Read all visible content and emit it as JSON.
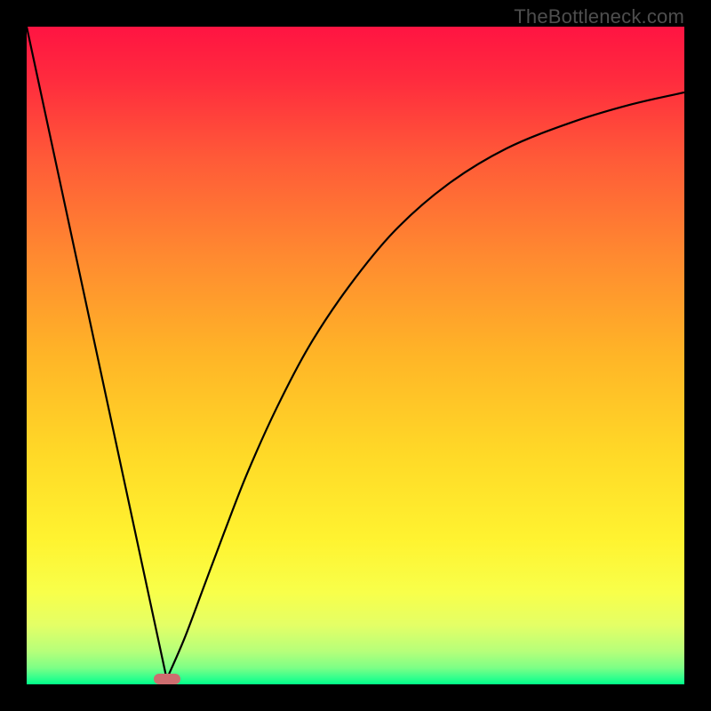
{
  "watermark": "TheBottleneck.com",
  "gradient_stops": [
    {
      "offset": 0.0,
      "color": "#ff1442"
    },
    {
      "offset": 0.08,
      "color": "#ff2b3e"
    },
    {
      "offset": 0.2,
      "color": "#ff5a38"
    },
    {
      "offset": 0.35,
      "color": "#ff8a30"
    },
    {
      "offset": 0.5,
      "color": "#ffb527"
    },
    {
      "offset": 0.65,
      "color": "#ffd927"
    },
    {
      "offset": 0.78,
      "color": "#fff330"
    },
    {
      "offset": 0.86,
      "color": "#f8ff4a"
    },
    {
      "offset": 0.91,
      "color": "#e4ff66"
    },
    {
      "offset": 0.95,
      "color": "#b6ff7a"
    },
    {
      "offset": 0.975,
      "color": "#7cff86"
    },
    {
      "offset": 0.99,
      "color": "#33ff8d"
    },
    {
      "offset": 1.0,
      "color": "#00ff88"
    }
  ],
  "marker": {
    "x_frac": 0.213,
    "y_frac": 0.992,
    "color": "#cd6d6f"
  },
  "curve_left": {
    "start": {
      "x_frac": 0.0,
      "y_frac": 0.0
    },
    "end": {
      "x_frac": 0.213,
      "y_frac": 0.992
    }
  },
  "curve_right": {
    "samples": [
      {
        "x_frac": 0.213,
        "y_frac": 0.992
      },
      {
        "x_frac": 0.24,
        "y_frac": 0.93
      },
      {
        "x_frac": 0.27,
        "y_frac": 0.85
      },
      {
        "x_frac": 0.3,
        "y_frac": 0.77
      },
      {
        "x_frac": 0.335,
        "y_frac": 0.68
      },
      {
        "x_frac": 0.38,
        "y_frac": 0.58
      },
      {
        "x_frac": 0.43,
        "y_frac": 0.485
      },
      {
        "x_frac": 0.49,
        "y_frac": 0.395
      },
      {
        "x_frac": 0.56,
        "y_frac": 0.31
      },
      {
        "x_frac": 0.64,
        "y_frac": 0.24
      },
      {
        "x_frac": 0.73,
        "y_frac": 0.185
      },
      {
        "x_frac": 0.83,
        "y_frac": 0.145
      },
      {
        "x_frac": 0.92,
        "y_frac": 0.118
      },
      {
        "x_frac": 1.0,
        "y_frac": 0.1
      }
    ]
  },
  "chart_data": {
    "type": "line",
    "title": "",
    "xlabel": "",
    "ylabel": "",
    "xlim": [
      0,
      1
    ],
    "ylim": [
      0,
      1
    ],
    "note": "Axes are unlabeled; values expressed as normalized fractions of the plot area (0 at left/top edges of usable chart rectangle).",
    "series": [
      {
        "name": "left-branch",
        "x": [
          0.0,
          0.213
        ],
        "y": [
          1.0,
          0.008
        ]
      },
      {
        "name": "right-branch",
        "x": [
          0.213,
          0.24,
          0.27,
          0.3,
          0.335,
          0.38,
          0.43,
          0.49,
          0.56,
          0.64,
          0.73,
          0.83,
          0.92,
          1.0
        ],
        "y": [
          0.008,
          0.07,
          0.15,
          0.23,
          0.32,
          0.42,
          0.515,
          0.605,
          0.69,
          0.76,
          0.815,
          0.855,
          0.882,
          0.9
        ]
      }
    ],
    "marker_point": {
      "x": 0.213,
      "y": 0.008,
      "note": "minimum / highlight"
    },
    "background_gradient": "vertical red→orange→yellow→green"
  }
}
